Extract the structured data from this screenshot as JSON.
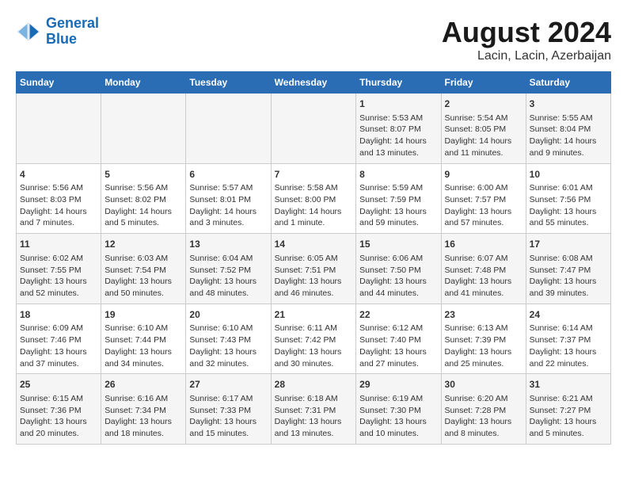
{
  "header": {
    "logo_general": "General",
    "logo_blue": "Blue",
    "title": "August 2024",
    "subtitle": "Lacin, Lacin, Azerbaijan"
  },
  "days_of_week": [
    "Sunday",
    "Monday",
    "Tuesday",
    "Wednesday",
    "Thursday",
    "Friday",
    "Saturday"
  ],
  "weeks": [
    [
      {
        "day": "",
        "info": ""
      },
      {
        "day": "",
        "info": ""
      },
      {
        "day": "",
        "info": ""
      },
      {
        "day": "",
        "info": ""
      },
      {
        "day": "1",
        "info": "Sunrise: 5:53 AM\nSunset: 8:07 PM\nDaylight: 14 hours\nand 13 minutes."
      },
      {
        "day": "2",
        "info": "Sunrise: 5:54 AM\nSunset: 8:05 PM\nDaylight: 14 hours\nand 11 minutes."
      },
      {
        "day": "3",
        "info": "Sunrise: 5:55 AM\nSunset: 8:04 PM\nDaylight: 14 hours\nand 9 minutes."
      }
    ],
    [
      {
        "day": "4",
        "info": "Sunrise: 5:56 AM\nSunset: 8:03 PM\nDaylight: 14 hours\nand 7 minutes."
      },
      {
        "day": "5",
        "info": "Sunrise: 5:56 AM\nSunset: 8:02 PM\nDaylight: 14 hours\nand 5 minutes."
      },
      {
        "day": "6",
        "info": "Sunrise: 5:57 AM\nSunset: 8:01 PM\nDaylight: 14 hours\nand 3 minutes."
      },
      {
        "day": "7",
        "info": "Sunrise: 5:58 AM\nSunset: 8:00 PM\nDaylight: 14 hours\nand 1 minute."
      },
      {
        "day": "8",
        "info": "Sunrise: 5:59 AM\nSunset: 7:59 PM\nDaylight: 13 hours\nand 59 minutes."
      },
      {
        "day": "9",
        "info": "Sunrise: 6:00 AM\nSunset: 7:57 PM\nDaylight: 13 hours\nand 57 minutes."
      },
      {
        "day": "10",
        "info": "Sunrise: 6:01 AM\nSunset: 7:56 PM\nDaylight: 13 hours\nand 55 minutes."
      }
    ],
    [
      {
        "day": "11",
        "info": "Sunrise: 6:02 AM\nSunset: 7:55 PM\nDaylight: 13 hours\nand 52 minutes."
      },
      {
        "day": "12",
        "info": "Sunrise: 6:03 AM\nSunset: 7:54 PM\nDaylight: 13 hours\nand 50 minutes."
      },
      {
        "day": "13",
        "info": "Sunrise: 6:04 AM\nSunset: 7:52 PM\nDaylight: 13 hours\nand 48 minutes."
      },
      {
        "day": "14",
        "info": "Sunrise: 6:05 AM\nSunset: 7:51 PM\nDaylight: 13 hours\nand 46 minutes."
      },
      {
        "day": "15",
        "info": "Sunrise: 6:06 AM\nSunset: 7:50 PM\nDaylight: 13 hours\nand 44 minutes."
      },
      {
        "day": "16",
        "info": "Sunrise: 6:07 AM\nSunset: 7:48 PM\nDaylight: 13 hours\nand 41 minutes."
      },
      {
        "day": "17",
        "info": "Sunrise: 6:08 AM\nSunset: 7:47 PM\nDaylight: 13 hours\nand 39 minutes."
      }
    ],
    [
      {
        "day": "18",
        "info": "Sunrise: 6:09 AM\nSunset: 7:46 PM\nDaylight: 13 hours\nand 37 minutes."
      },
      {
        "day": "19",
        "info": "Sunrise: 6:10 AM\nSunset: 7:44 PM\nDaylight: 13 hours\nand 34 minutes."
      },
      {
        "day": "20",
        "info": "Sunrise: 6:10 AM\nSunset: 7:43 PM\nDaylight: 13 hours\nand 32 minutes."
      },
      {
        "day": "21",
        "info": "Sunrise: 6:11 AM\nSunset: 7:42 PM\nDaylight: 13 hours\nand 30 minutes."
      },
      {
        "day": "22",
        "info": "Sunrise: 6:12 AM\nSunset: 7:40 PM\nDaylight: 13 hours\nand 27 minutes."
      },
      {
        "day": "23",
        "info": "Sunrise: 6:13 AM\nSunset: 7:39 PM\nDaylight: 13 hours\nand 25 minutes."
      },
      {
        "day": "24",
        "info": "Sunrise: 6:14 AM\nSunset: 7:37 PM\nDaylight: 13 hours\nand 22 minutes."
      }
    ],
    [
      {
        "day": "25",
        "info": "Sunrise: 6:15 AM\nSunset: 7:36 PM\nDaylight: 13 hours\nand 20 minutes."
      },
      {
        "day": "26",
        "info": "Sunrise: 6:16 AM\nSunset: 7:34 PM\nDaylight: 13 hours\nand 18 minutes."
      },
      {
        "day": "27",
        "info": "Sunrise: 6:17 AM\nSunset: 7:33 PM\nDaylight: 13 hours\nand 15 minutes."
      },
      {
        "day": "28",
        "info": "Sunrise: 6:18 AM\nSunset: 7:31 PM\nDaylight: 13 hours\nand 13 minutes."
      },
      {
        "day": "29",
        "info": "Sunrise: 6:19 AM\nSunset: 7:30 PM\nDaylight: 13 hours\nand 10 minutes."
      },
      {
        "day": "30",
        "info": "Sunrise: 6:20 AM\nSunset: 7:28 PM\nDaylight: 13 hours\nand 8 minutes."
      },
      {
        "day": "31",
        "info": "Sunrise: 6:21 AM\nSunset: 7:27 PM\nDaylight: 13 hours\nand 5 minutes."
      }
    ]
  ]
}
